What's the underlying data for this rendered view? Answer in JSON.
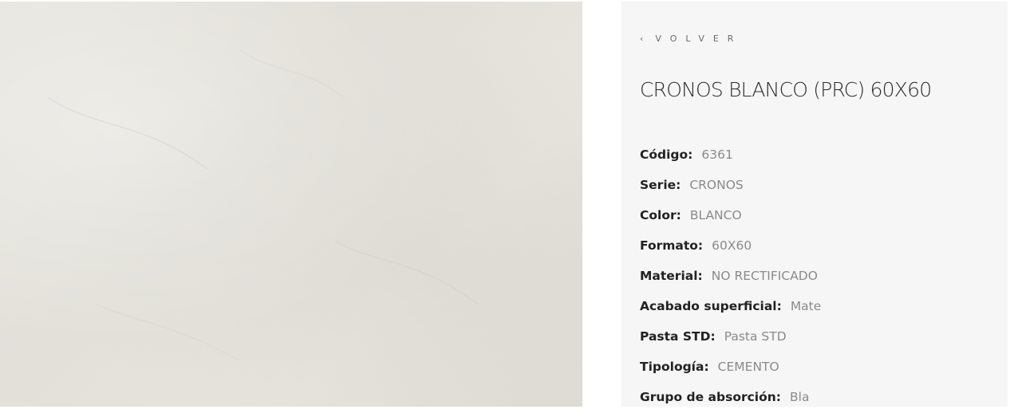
{
  "image": {
    "alt": "CRONOS BLANCO (PRC) 60X60",
    "base_color": "#e4e2db"
  },
  "back": {
    "icon": "chevron-left-icon",
    "label": "VOLVER"
  },
  "product": {
    "title": "CRONOS BLANCO (PRC) 60X60"
  },
  "specs": [
    {
      "key": "Código:",
      "value": "6361"
    },
    {
      "key": "Serie:",
      "value": "CRONOS"
    },
    {
      "key": "Color:",
      "value": "BLANCO"
    },
    {
      "key": "Formato:",
      "value": "60X60"
    },
    {
      "key": "Material:",
      "value": "NO RECTIFICADO"
    },
    {
      "key": "Acabado superficial:",
      "value": "Mate"
    },
    {
      "key": "Pasta STD:",
      "value": "Pasta STD"
    },
    {
      "key": "Tipología:",
      "value": "CEMENTO"
    },
    {
      "key": "Grupo de absorción:",
      "value": "Bla"
    }
  ],
  "colors": {
    "panel_bg": "#f6f6f6",
    "label": "#222222",
    "value": "#8a8a8a",
    "title": "#2c2c2c"
  }
}
